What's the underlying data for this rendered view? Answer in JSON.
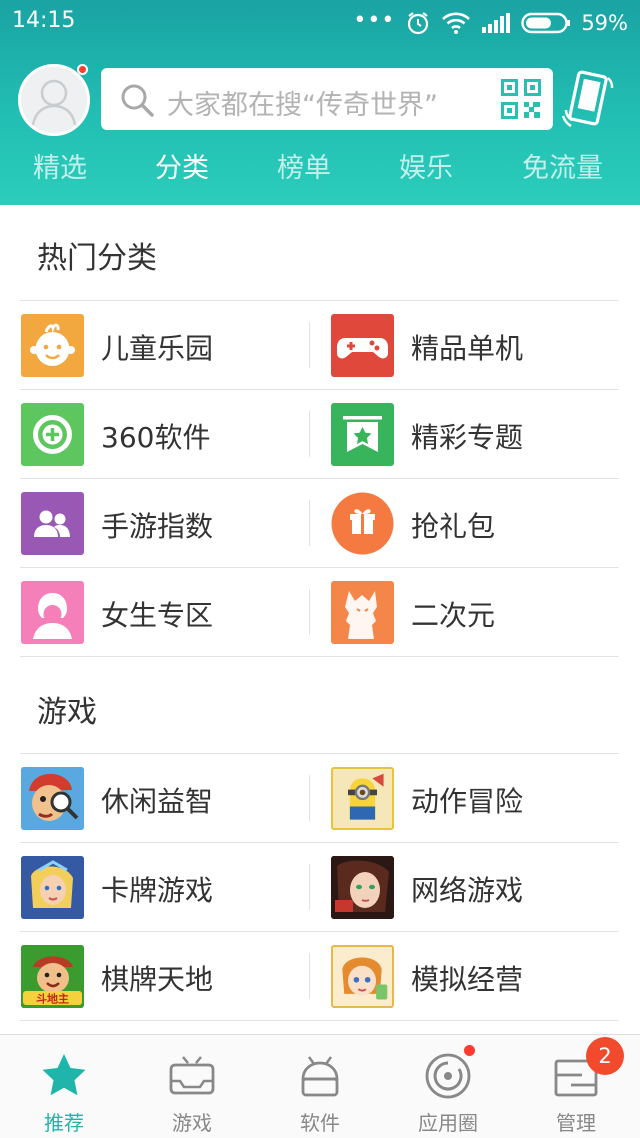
{
  "status_bar": {
    "time": "14:15",
    "dots": "•••",
    "battery": "59%"
  },
  "header": {
    "search_placeholder": "大家都在搜“传奇世界”",
    "tabs": [
      {
        "label": "精选",
        "active": false
      },
      {
        "label": "分类",
        "active": true
      },
      {
        "label": "榜单",
        "active": false
      },
      {
        "label": "娱乐",
        "active": false
      },
      {
        "label": "免流量",
        "active": false
      }
    ]
  },
  "hot_categories": {
    "title": "热门分类",
    "items": [
      {
        "label": "儿童乐园",
        "icon": "baby-face-icon",
        "color": "#f3a73f"
      },
      {
        "label": "精品单机",
        "icon": "gamepad-icon",
        "color": "#e0483c"
      },
      {
        "label": "360软件",
        "icon": "plus-circle-icon",
        "color": "#5dc65f"
      },
      {
        "label": "精彩专题",
        "icon": "banner-star-icon",
        "color": "#37b45c"
      },
      {
        "label": "手游指数",
        "icon": "users-icon",
        "color": "#9a58b5"
      },
      {
        "label": "抢礼包",
        "icon": "gift-icon",
        "color": "#f47a42"
      },
      {
        "label": "女生专区",
        "icon": "girl-icon",
        "color": "#f47fb9"
      },
      {
        "label": "二次元",
        "icon": "anime-character-icon",
        "color": "#f5864a"
      }
    ]
  },
  "games": {
    "title": "游戏",
    "items": [
      {
        "label": "休闲益智",
        "icon": "casual-game-icon"
      },
      {
        "label": "动作冒险",
        "icon": "minion-icon"
      },
      {
        "label": "卡牌游戏",
        "icon": "card-hero-icon"
      },
      {
        "label": "网络游戏",
        "icon": "online-game-girl-icon"
      },
      {
        "label": "棋牌天地",
        "icon": "doudizhu-icon",
        "logo_text": "斗地主"
      },
      {
        "label": "模拟经营",
        "icon": "sim-girl-icon"
      }
    ]
  },
  "bottom_nav": {
    "items": [
      {
        "label": "推荐",
        "icon": "star-icon",
        "active": true
      },
      {
        "label": "游戏",
        "icon": "gamepad-outline-icon",
        "active": false
      },
      {
        "label": "软件",
        "icon": "android-icon",
        "active": false
      },
      {
        "label": "应用圈",
        "icon": "camera-ring-icon",
        "active": false,
        "dot": true
      },
      {
        "label": "管理",
        "icon": "manage-box-icon",
        "active": false,
        "badge": "2"
      }
    ]
  },
  "colors": {
    "accent": "#1fb5ab",
    "header_top": "#1aa3a3",
    "header_bottom": "#2ccdbb",
    "badge": "#f24a2d"
  }
}
